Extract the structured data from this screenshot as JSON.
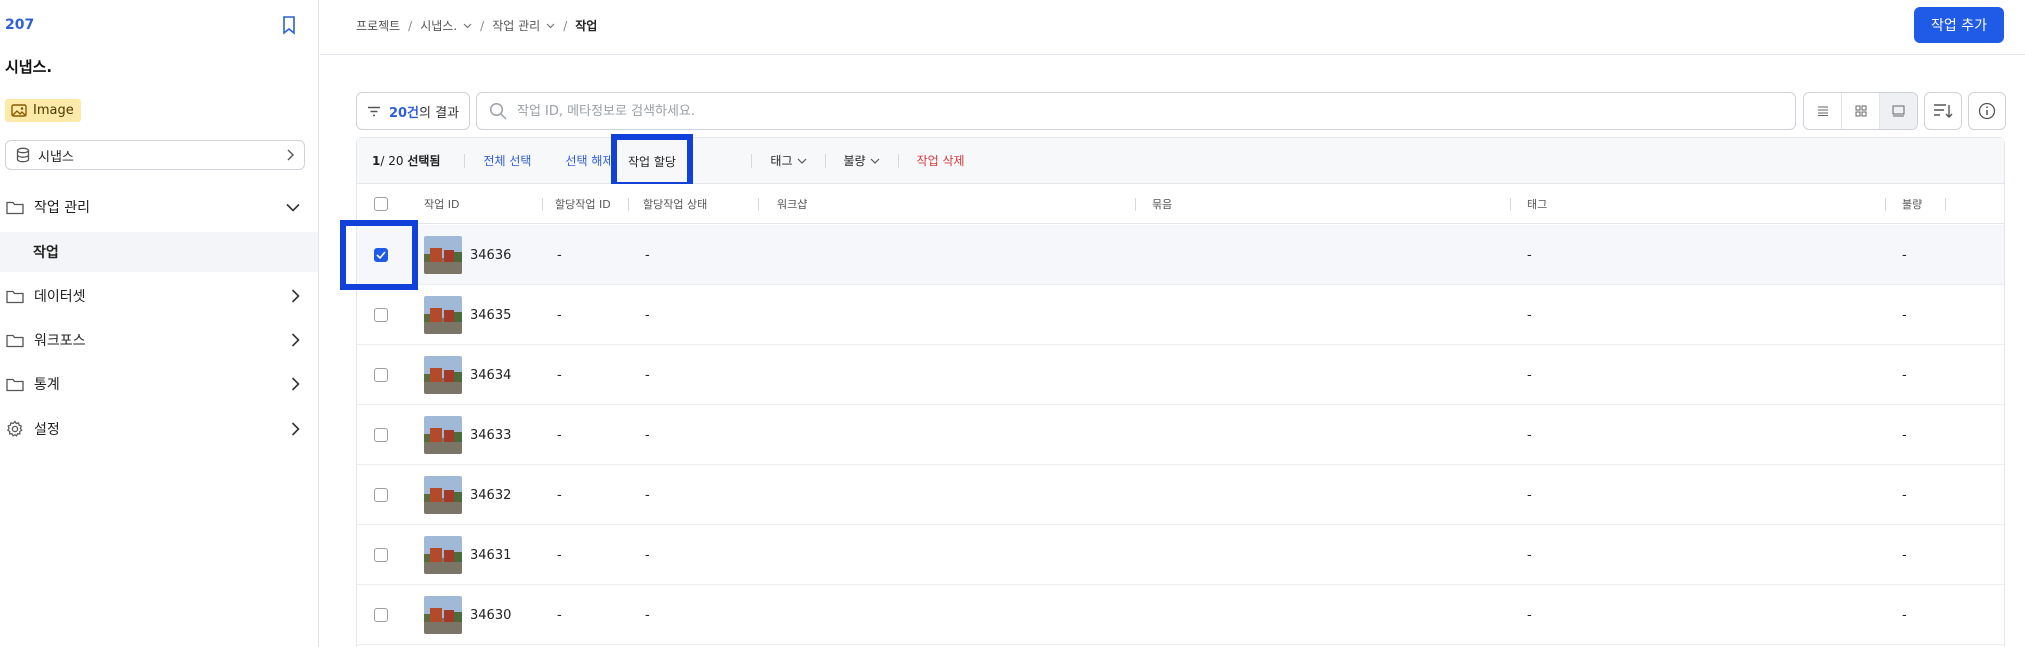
{
  "sidebar": {
    "project_id": "207",
    "project_name": "시냅스.",
    "badge_label": "Image",
    "dataset_select": "시냅스",
    "nav": [
      {
        "label": "작업 관리",
        "expanded": true
      },
      {
        "label": "데이터셋"
      },
      {
        "label": "워크포스"
      },
      {
        "label": "통계"
      },
      {
        "label": "설정"
      }
    ],
    "sub_item": "작업"
  },
  "header": {
    "breadcrumb": [
      "프로젝트",
      "시냅스.",
      "작업 관리",
      "작업"
    ],
    "add_button": "작업 추가"
  },
  "toolbar": {
    "filter_count": "20건",
    "filter_suffix": "의 결과",
    "search_placeholder": "작업 ID, 메타정보로 검색하세요."
  },
  "actions": {
    "selected": "1",
    "total": "/ 20",
    "selected_suffix": "선택됨",
    "select_all": "전체 선택",
    "deselect": "선택 해제",
    "assign": "작업 할당",
    "tag": "태그",
    "defect": "불량",
    "delete": "작업 삭제"
  },
  "columns": [
    "작업 ID",
    "할당작업 ID",
    "할당작업 상태",
    "워크샵",
    "묶음",
    "태그",
    "불량"
  ],
  "rows": [
    {
      "id": "34636",
      "assign_id": "-",
      "assign_status": "-",
      "tag": "-",
      "defect": "-",
      "checked": true
    },
    {
      "id": "34635",
      "assign_id": "-",
      "assign_status": "-",
      "tag": "-",
      "defect": "-",
      "checked": false
    },
    {
      "id": "34634",
      "assign_id": "-",
      "assign_status": "-",
      "tag": "-",
      "defect": "-",
      "checked": false
    },
    {
      "id": "34633",
      "assign_id": "-",
      "assign_status": "-",
      "tag": "-",
      "defect": "-",
      "checked": false
    },
    {
      "id": "34632",
      "assign_id": "-",
      "assign_status": "-",
      "tag": "-",
      "defect": "-",
      "checked": false
    },
    {
      "id": "34631",
      "assign_id": "-",
      "assign_status": "-",
      "tag": "-",
      "defect": "-",
      "checked": false
    },
    {
      "id": "34630",
      "assign_id": "-",
      "assign_status": "-",
      "tag": "-",
      "defect": "-",
      "checked": false
    }
  ],
  "colors": {
    "accent": "#1f5be6",
    "highlight": "#1141d9",
    "danger": "#d93838",
    "badge_bg": "#fde9a8"
  }
}
